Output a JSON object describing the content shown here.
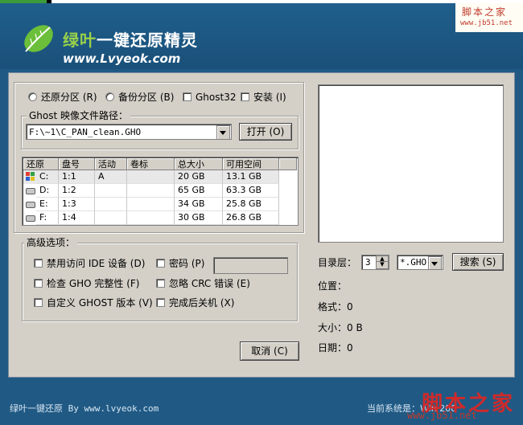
{
  "header": {
    "brand_prefix": "绿叶",
    "brand_suffix": "一键还原精灵",
    "site": "www.Lvyeok.com",
    "watermark_top": "脚本之家",
    "watermark_top_url": "www.jb51.net"
  },
  "mode": {
    "restore": "还原分区 (R)",
    "backup": "备份分区 (B)",
    "ghost32": "Ghost32",
    "install": "安装 (I)"
  },
  "ghost_path": {
    "legend": "Ghost 映像文件路径：",
    "value": "F:\\~1\\C_PAN_clean.GHO",
    "open_button": "打开 (O)"
  },
  "partitions": {
    "columns": [
      "还原",
      "盘号",
      "活动",
      "卷标",
      "总大小",
      "可用空间"
    ],
    "rows": [
      {
        "drive": "C:",
        "number": "1:1",
        "active": "A",
        "label": "",
        "total": "20 GB",
        "free": "13.1 GB"
      },
      {
        "drive": "D:",
        "number": "1:2",
        "active": "",
        "label": "",
        "total": "65 GB",
        "free": "63.3 GB"
      },
      {
        "drive": "E:",
        "number": "1:3",
        "active": "",
        "label": "",
        "total": "34 GB",
        "free": "25.8 GB"
      },
      {
        "drive": "F:",
        "number": "1:4",
        "active": "",
        "label": "",
        "total": "30 GB",
        "free": "26.8 GB"
      }
    ]
  },
  "advanced": {
    "legend": "高级选项：",
    "ide": "禁用访问 IDE 设备 (D)",
    "password": "密码 (P)",
    "check_gho": "检查 GHO 完整性 (F)",
    "ignore_crc": "忽略 CRC 错误 (E)",
    "custom_ghost": "自定义 GHOST 版本 (V)",
    "shutdown": "完成后关机 (X)"
  },
  "search": {
    "dir_level_label": "目录层：",
    "dir_level_value": "3",
    "filter_value": "*.GHO",
    "search_button": "搜索 (S)"
  },
  "info": {
    "location": "位置：",
    "format": "格式：0",
    "size": "大小：0 B",
    "date": "日期：0"
  },
  "cancel_button": "取消 (C)",
  "footer": {
    "left": "绿叶一键还原 By www.lvyeok.com",
    "right": "当前系统是：Win 200",
    "watermark": "脚本之家",
    "watermark_url": "www.jb51.net"
  },
  "colors": {
    "window_blue": "#205a84",
    "dialog_gray": "#d4d0c8",
    "leaf_green": "#6bbf3a",
    "watermark_red": "#d02a2a"
  }
}
